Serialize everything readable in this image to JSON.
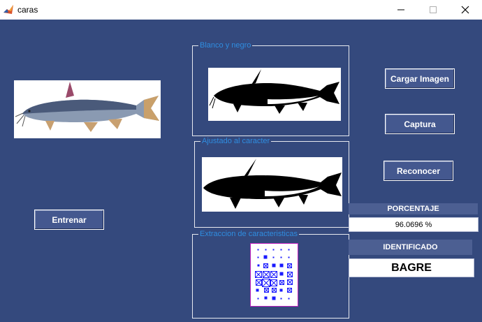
{
  "window": {
    "title": "caras"
  },
  "panels": {
    "bw": {
      "title": "Blanco y negro"
    },
    "adjusted": {
      "title": "Ajustado al caracter"
    },
    "features": {
      "title": "Extraccion de caracteristicas"
    }
  },
  "buttons": {
    "load": "Cargar Imagen",
    "capture": "Captura",
    "recognize": "Reconocer",
    "train": "Entrenar"
  },
  "results": {
    "percentage_label": "PORCENTAJE",
    "percentage_value": "96.0696 %",
    "identified_label": "IDENTIFICADO",
    "identified_value": "BAGRE"
  },
  "colors": {
    "background": "#34497d",
    "panel_title": "#2f8de0",
    "feature_grid": "#1a1aff",
    "feature_border": "#c020c0"
  }
}
